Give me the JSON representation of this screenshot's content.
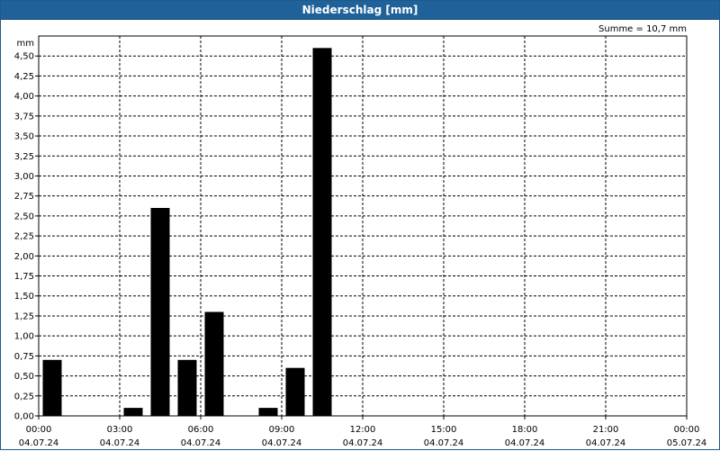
{
  "window": {
    "title": "Niederschlag [mm]"
  },
  "summary": {
    "text": "Summe = 10,7 mm"
  },
  "chart_data": {
    "type": "bar",
    "title": "Niederschlag [mm]",
    "ylabel": "mm",
    "ylim": [
      0,
      4.75
    ],
    "ytick_labels": [
      "0,00",
      "0,25",
      "0,50",
      "0,75",
      "1,00",
      "1,25",
      "1,50",
      "1,75",
      "2,00",
      "2,25",
      "2,50",
      "2,75",
      "3,00",
      "3,25",
      "3,50",
      "3,75",
      "4,00",
      "4,25",
      "4,50"
    ],
    "xtick_labels": [
      [
        "00:00",
        "04.07.24"
      ],
      [
        "03:00",
        "04.07.24"
      ],
      [
        "06:00",
        "04.07.24"
      ],
      [
        "09:00",
        "04.07.24"
      ],
      [
        "12:00",
        "04.07.24"
      ],
      [
        "15:00",
        "04.07.24"
      ],
      [
        "18:00",
        "04.07.24"
      ],
      [
        "21:00",
        "04.07.24"
      ],
      [
        "00:00",
        "05.07.24"
      ]
    ],
    "x_unit": "hours since 04.07.24 00:00",
    "xlim": [
      0,
      24
    ],
    "bars": [
      {
        "x": 0,
        "value": 0.7
      },
      {
        "x": 3,
        "value": 0.1
      },
      {
        "x": 4,
        "value": 2.6
      },
      {
        "x": 5,
        "value": 0.7
      },
      {
        "x": 6,
        "value": 1.3
      },
      {
        "x": 8,
        "value": 0.1
      },
      {
        "x": 9,
        "value": 0.6
      },
      {
        "x": 10,
        "value": 4.6
      }
    ],
    "grid": true,
    "bar_color": "#000000"
  }
}
